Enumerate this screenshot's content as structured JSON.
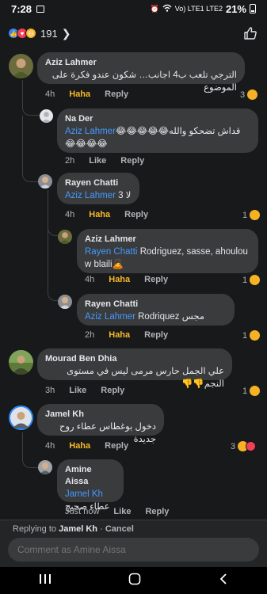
{
  "status": {
    "time": "7:28",
    "network": "Vo) LTE1 LTE2",
    "battery": "21%"
  },
  "header": {
    "reaction_count": "191"
  },
  "comments": [
    {
      "author": "Aziz Lahmer",
      "text": "الترجي تلعب ب4 اجانب… شكون عندو فكرة على الموضوع",
      "time": "4h",
      "haha": "Haha",
      "reply": "Reply",
      "count": "3"
    },
    {
      "author": "Na Der",
      "mention": "Aziz Lahmer",
      "text": "قداش تضحكو والله😂😂😂😂😂",
      "text2": "😂😂😂😂",
      "time": "2h",
      "like": "Like",
      "reply": "Reply"
    },
    {
      "author": "Rayen Chatti",
      "mention": "Aziz Lahmer",
      "text": "لا 3",
      "time": "4h",
      "haha": "Haha",
      "reply": "Reply",
      "count": "1"
    },
    {
      "author": "Aziz Lahmer",
      "mention": "Rayen Chatti",
      "text": "Rodriguez, sasse, ahoulou",
      "text2": "w blaili🙇",
      "time": "4h",
      "haha": "Haha",
      "reply": "Reply",
      "count": "1"
    },
    {
      "author": "Rayen Chatti",
      "mention": "Aziz Lahmer",
      "text": "Rodriquez مجس",
      "time": "2h",
      "haha": "Haha",
      "reply": "Reply",
      "count": "1"
    },
    {
      "author": "Mourad Ben Dhia",
      "text": "علي الجمل حارس مرمى ليس في مستوى النجم👎👎",
      "time": "3h",
      "like": "Like",
      "reply": "Reply",
      "count": "1"
    },
    {
      "author": "Jamel Kh",
      "text": "دخول بوغطاس عطاء روح جديدة",
      "time": "4h",
      "haha": "Haha",
      "reply": "Reply",
      "count": "3"
    },
    {
      "author": "Amine Aissa",
      "mention": "Jamel Kh",
      "text": "عطاء صحيح",
      "time": "Just now",
      "like": "Like",
      "reply": "Reply"
    }
  ],
  "reply_bar": {
    "prefix": "Replying to",
    "name": "Jamel Kh",
    "sep": " · ",
    "cancel": "Cancel",
    "placeholder": "Comment as Amine Aissa"
  },
  "nav": {
    "recents_icon": "recents-icon",
    "home_icon": "home-icon",
    "back_icon": "back-icon"
  },
  "colors": {
    "background": "#18191a",
    "bubble": "#3a3b3c",
    "mention": "#4599ff",
    "haha": "#f7b928"
  }
}
